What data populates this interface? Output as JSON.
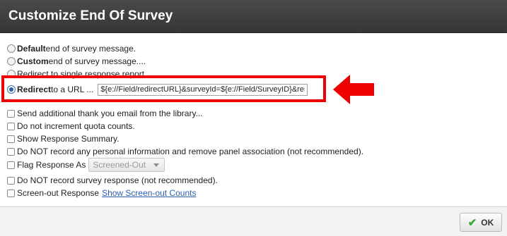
{
  "dialog": {
    "title": "Customize End Of Survey"
  },
  "options": {
    "default": {
      "bold": "Default",
      "rest": " end of survey message."
    },
    "custom": {
      "bold": "Custom",
      "rest": " end of survey message...."
    },
    "single_report": {
      "text": "Redirect to single response report"
    },
    "redirect": {
      "bold": "Redirect",
      "rest": " to a URL ...",
      "url_value": "${e://Field/redirectURL}&surveyId=${e://Field/SurveyID}&responseId=${e://Field/ResponseID}"
    }
  },
  "checkboxes": {
    "thank_you": "Send additional thank you email from the library...",
    "quota": "Do not increment quota counts.",
    "summary": "Show Response Summary.",
    "no_pii": "Do NOT record any personal information and remove panel association (not recommended).",
    "flag": "Flag Response As",
    "flag_value": "Screened-Out",
    "no_record": "Do NOT record survey response (not recommended).",
    "screen_out": "Screen-out Response",
    "screen_out_link": "Show Screen-out Counts"
  },
  "footer": {
    "ok_label": "OK"
  },
  "annotation": {
    "highlight_color": "#ee0000"
  }
}
